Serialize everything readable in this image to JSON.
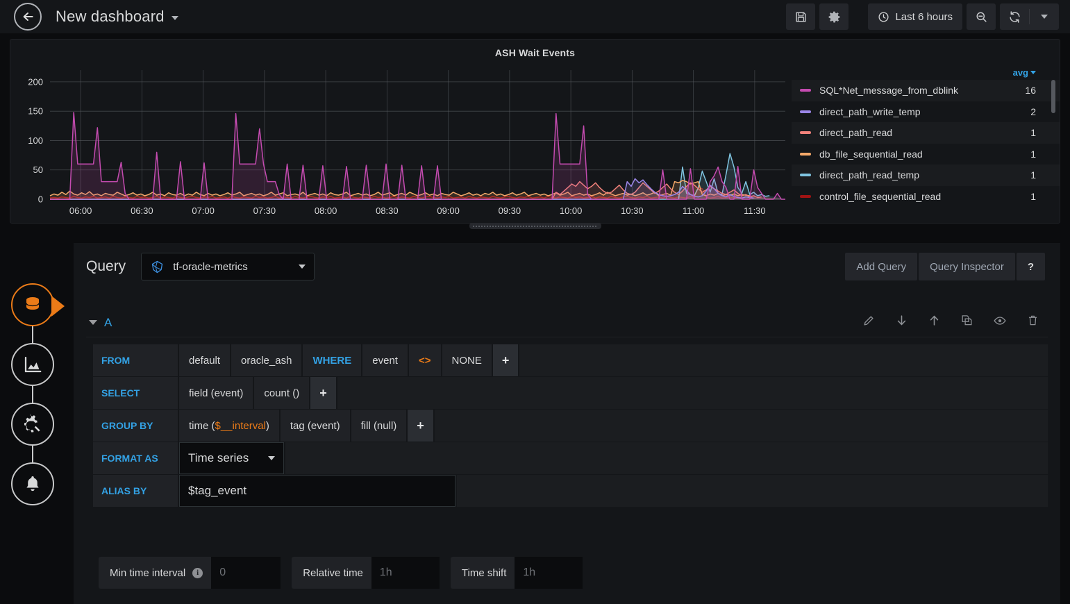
{
  "topnav": {
    "back_icon": "arrow-left-circle-icon",
    "title": "New dashboard",
    "save_icon": "save-disk-icon",
    "settings_icon": "gear-icon",
    "time_range": "Last 6 hours",
    "clock_icon": "clock-icon",
    "zoom_out_icon": "search-minus-icon",
    "refresh_icon": "refresh-icon",
    "refresh_caret_icon": "chevron-down-icon"
  },
  "panel": {
    "title": "ASH Wait Events",
    "legend_sort_label": "avg",
    "legend": [
      {
        "name": "SQL*Net_message_from_dblink",
        "value": "16",
        "color": "#c44bb0"
      },
      {
        "name": "direct_path_write_temp",
        "value": "2",
        "color": "#9b86e8"
      },
      {
        "name": "direct_path_read",
        "value": "1",
        "color": "#f2827b"
      },
      {
        "name": "db_file_sequential_read",
        "value": "1",
        "color": "#f5a96a"
      },
      {
        "name": "direct_path_read_temp",
        "value": "1",
        "color": "#7fc4e0"
      },
      {
        "name": "control_file_sequential_read",
        "value": "1",
        "color": "#a01313"
      }
    ]
  },
  "chart_data": {
    "type": "line",
    "title": "ASH Wait Events",
    "xlabel": "",
    "ylabel": "",
    "ylim": [
      0,
      220
    ],
    "yticks": [
      "0",
      "50",
      "100",
      "150",
      "200"
    ],
    "xticks": [
      "06:00",
      "06:30",
      "07:00",
      "07:30",
      "08:00",
      "08:30",
      "09:00",
      "09:30",
      "10:00",
      "10:30",
      "11:00",
      "11:30"
    ],
    "grid": true,
    "legend_position": "right",
    "legend_columns": [
      "avg"
    ],
    "series": [
      {
        "name": "SQL*Net_message_from_dblink",
        "color": "#c44bb0",
        "avg": 16,
        "values": [
          0,
          0,
          0,
          0,
          0,
          0,
          148,
          60,
          60,
          60,
          60,
          60,
          122,
          30,
          30,
          30,
          30,
          30,
          63,
          10,
          0,
          0,
          0,
          0,
          0,
          0,
          0,
          80,
          0,
          0,
          0,
          0,
          0,
          64,
          0,
          0,
          0,
          0,
          0,
          62,
          0,
          0,
          0,
          0,
          0,
          0,
          0,
          146,
          60,
          60,
          60,
          60,
          60,
          120,
          60,
          30,
          30,
          30,
          8,
          0,
          60,
          0,
          0,
          0,
          58,
          0,
          0,
          0,
          0,
          57,
          0,
          0,
          0,
          0,
          0,
          56,
          0,
          0,
          0,
          0,
          58,
          0,
          0,
          0,
          0,
          60,
          0,
          0,
          0,
          58,
          0,
          0,
          0,
          0,
          57,
          0,
          0,
          0,
          57,
          0,
          0,
          0,
          0,
          0,
          0,
          0,
          0,
          0,
          0,
          0,
          0,
          0,
          0,
          0,
          0,
          0,
          0,
          0,
          0,
          0,
          0,
          0,
          0,
          0,
          0,
          0,
          0,
          0,
          146,
          60,
          60,
          60,
          60,
          60,
          60,
          125,
          8,
          0,
          0,
          0,
          0,
          0,
          0,
          0,
          0,
          0,
          0,
          0,
          0,
          0,
          0,
          0,
          0,
          0,
          0,
          50,
          0,
          0,
          0,
          0,
          0,
          0,
          52,
          0,
          0,
          0,
          0,
          30,
          40,
          55,
          30,
          20,
          0,
          0,
          56,
          0,
          0,
          0,
          50,
          20,
          10,
          0,
          0,
          0,
          10,
          0,
          0
        ]
      },
      {
        "name": "direct_path_write_temp",
        "color": "#9b86e8",
        "avg": 2,
        "values": [
          0,
          0,
          0,
          0,
          0,
          0,
          0,
          0,
          0,
          0,
          0,
          0,
          0,
          0,
          0,
          0,
          0,
          0,
          0,
          0,
          0,
          0,
          0,
          0,
          0,
          0,
          0,
          0,
          0,
          0,
          0,
          0,
          0,
          0,
          0,
          0,
          0,
          0,
          0,
          0,
          0,
          0,
          0,
          0,
          0,
          0,
          0,
          0,
          0,
          0,
          0,
          0,
          0,
          0,
          0,
          0,
          0,
          0,
          0,
          0,
          0,
          0,
          0,
          0,
          0,
          0,
          0,
          0,
          0,
          0,
          0,
          0,
          0,
          0,
          0,
          0,
          0,
          0,
          0,
          0,
          0,
          0,
          0,
          0,
          0,
          0,
          0,
          0,
          0,
          0,
          0,
          0,
          0,
          0,
          0,
          0,
          0,
          0,
          0,
          0,
          0,
          0,
          0,
          0,
          0,
          0,
          0,
          0,
          0,
          0,
          0,
          0,
          0,
          0,
          0,
          0,
          0,
          0,
          0,
          0,
          0,
          0,
          0,
          0,
          0,
          0,
          0,
          0,
          0,
          0,
          0,
          0,
          0,
          0,
          0,
          0,
          0,
          0,
          0,
          0,
          0,
          0,
          0,
          0,
          0,
          0,
          30,
          22,
          35,
          28,
          33,
          25,
          18,
          12,
          8,
          6,
          5,
          6,
          8,
          12,
          22,
          15,
          8,
          5,
          4,
          6,
          14,
          24,
          18,
          10,
          6,
          4,
          8,
          5,
          3,
          2,
          4,
          3,
          2
        ]
      },
      {
        "name": "direct_path_read",
        "color": "#f2827b",
        "avg": 1,
        "values": [
          0,
          0,
          0,
          0,
          0,
          0,
          0,
          0,
          0,
          0,
          0,
          0,
          0,
          0,
          0,
          0,
          0,
          0,
          0,
          0,
          0,
          0,
          0,
          0,
          0,
          0,
          0,
          0,
          0,
          0,
          0,
          0,
          0,
          0,
          0,
          0,
          0,
          0,
          0,
          0,
          0,
          0,
          0,
          0,
          0,
          0,
          0,
          0,
          0,
          0,
          0,
          0,
          0,
          0,
          0,
          0,
          0,
          0,
          0,
          0,
          0,
          0,
          0,
          0,
          0,
          0,
          0,
          0,
          0,
          0,
          0,
          0,
          0,
          0,
          0,
          0,
          0,
          0,
          0,
          0,
          0,
          0,
          0,
          0,
          0,
          0,
          0,
          0,
          0,
          0,
          0,
          0,
          0,
          0,
          0,
          0,
          0,
          0,
          0,
          0,
          0,
          0,
          0,
          0,
          0,
          0,
          0,
          0,
          0,
          0,
          0,
          0,
          0,
          0,
          0,
          0,
          0,
          0,
          0,
          0,
          0,
          0,
          0,
          0,
          0,
          0,
          0,
          0,
          12,
          8,
          14,
          20,
          26,
          22,
          30,
          24,
          18,
          22,
          28,
          20,
          14,
          10,
          12,
          18,
          24,
          16,
          10,
          8,
          12,
          20,
          28,
          22,
          16,
          10,
          14,
          20,
          26,
          18,
          12,
          8,
          14,
          22,
          28,
          24,
          18,
          12,
          16,
          22,
          18,
          14,
          10,
          8,
          12,
          16,
          10,
          6,
          8,
          4,
          6,
          3,
          4
        ]
      },
      {
        "name": "db_file_sequential_read",
        "color": "#f5a96a",
        "avg": 1,
        "values": [
          6,
          9,
          7,
          12,
          8,
          14,
          9,
          7,
          11,
          8,
          13,
          7,
          9,
          6,
          10,
          8,
          7,
          12,
          9,
          6,
          8,
          11,
          7,
          9,
          6,
          8,
          12,
          7,
          9,
          6,
          11,
          8,
          7,
          10,
          6,
          9,
          7,
          12,
          8,
          6,
          10,
          7,
          9,
          6,
          8,
          11,
          7,
          9,
          12,
          6,
          8,
          10,
          7,
          9,
          6,
          8,
          12,
          7,
          9,
          11,
          6,
          8,
          9,
          7,
          12,
          6,
          8,
          10,
          7,
          9,
          6,
          11,
          8,
          7,
          9,
          12,
          6,
          8,
          10,
          7,
          9,
          6,
          8,
          12,
          7,
          9,
          11,
          6,
          8,
          10,
          7,
          12,
          9,
          6,
          8,
          11,
          7,
          9,
          6,
          10,
          8,
          7,
          12,
          9,
          6,
          8,
          11,
          7,
          9,
          6,
          10,
          8,
          12,
          7,
          9,
          6,
          8,
          11,
          7,
          9,
          12,
          6,
          8,
          10,
          7,
          9,
          6,
          8,
          11,
          7,
          9,
          12,
          6,
          8,
          10,
          7,
          9,
          6,
          8,
          11,
          7,
          12,
          9,
          6,
          8,
          10,
          7,
          9,
          6,
          8,
          11,
          7,
          9,
          12,
          6,
          8,
          10,
          7,
          30,
          28,
          32,
          30,
          26,
          28,
          30,
          8,
          6,
          9,
          7,
          10,
          6,
          8,
          7,
          9,
          6,
          8,
          7,
          6
        ]
      },
      {
        "name": "direct_path_read_temp",
        "color": "#7fc4e0",
        "avg": 1,
        "values": [
          0,
          0,
          0,
          0,
          0,
          0,
          0,
          0,
          0,
          0,
          0,
          0,
          0,
          0,
          0,
          0,
          0,
          0,
          0,
          0,
          0,
          0,
          0,
          0,
          0,
          0,
          0,
          0,
          0,
          0,
          0,
          0,
          0,
          0,
          0,
          0,
          0,
          0,
          0,
          0,
          0,
          0,
          0,
          0,
          0,
          0,
          0,
          0,
          0,
          0,
          0,
          0,
          0,
          0,
          0,
          0,
          0,
          0,
          0,
          0,
          0,
          0,
          0,
          0,
          0,
          0,
          0,
          0,
          0,
          0,
          0,
          0,
          0,
          0,
          0,
          0,
          0,
          0,
          0,
          0,
          0,
          0,
          0,
          0,
          0,
          0,
          0,
          0,
          0,
          0,
          0,
          0,
          0,
          0,
          0,
          0,
          0,
          0,
          0,
          0,
          0,
          0,
          0,
          0,
          0,
          0,
          0,
          0,
          0,
          0,
          0,
          0,
          0,
          0,
          0,
          0,
          0,
          0,
          0,
          0,
          0,
          0,
          0,
          0,
          0,
          0,
          0,
          0,
          0,
          0,
          0,
          0,
          0,
          0,
          0,
          0,
          0,
          0,
          0,
          0,
          0,
          0,
          0,
          0,
          0,
          0,
          0,
          0,
          0,
          0,
          0,
          0,
          0,
          0,
          0,
          0,
          0,
          0,
          0,
          0,
          55,
          10,
          8,
          6,
          20,
          48,
          30,
          12,
          35,
          10,
          8,
          42,
          78,
          55,
          20,
          10,
          30,
          8,
          12,
          6,
          8,
          5,
          6
        ]
      },
      {
        "name": "control_file_sequential_read",
        "color": "#a01313",
        "avg": 1,
        "values": [
          2,
          3,
          2,
          4,
          3,
          2,
          5,
          3,
          2,
          4,
          3,
          5,
          2,
          3,
          4,
          2,
          5,
          3,
          2,
          4,
          3,
          2,
          5,
          3,
          4,
          2,
          3,
          5,
          2,
          4,
          3,
          2,
          5,
          3,
          2,
          4,
          5,
          3,
          2,
          4,
          3,
          5,
          2,
          3,
          4,
          2,
          5,
          3,
          2,
          4,
          3,
          2,
          5,
          3,
          4,
          2,
          3,
          5,
          2,
          4,
          3,
          2,
          5,
          3,
          2,
          4,
          5,
          3,
          2,
          4,
          3,
          5,
          2,
          3,
          4,
          2,
          5,
          3,
          2,
          4,
          3,
          2,
          5,
          3,
          4,
          2,
          3,
          5,
          2,
          4,
          3,
          2,
          5,
          3,
          2,
          4,
          5,
          3,
          2,
          4,
          3,
          5,
          2,
          3,
          4,
          2,
          5,
          3,
          2,
          4,
          3,
          2,
          5,
          3,
          2,
          4,
          5,
          3,
          2,
          4,
          3,
          5,
          2,
          3,
          4,
          2,
          5,
          3,
          2,
          4,
          3,
          2,
          5,
          3,
          4,
          2,
          3,
          5,
          2,
          4,
          3,
          2,
          5,
          3,
          2,
          4,
          5,
          3,
          2,
          4,
          3,
          5,
          2,
          3,
          4,
          2,
          5,
          3,
          2,
          4,
          3,
          2,
          5,
          3,
          20,
          18,
          4,
          2,
          3,
          5,
          2,
          3,
          4,
          2,
          3,
          2
        ]
      }
    ]
  },
  "rail": {
    "items": [
      {
        "name": "queries-tab",
        "icon": "database-icon",
        "active": true
      },
      {
        "name": "visualization-tab",
        "icon": "chart-area-icon",
        "active": false
      },
      {
        "name": "general-settings-tab",
        "icon": "gear-wrench-icon",
        "active": false
      },
      {
        "name": "alert-tab",
        "icon": "bell-icon",
        "active": false
      }
    ]
  },
  "editor": {
    "query_label": "Query",
    "datasource": "tf-oracle-metrics",
    "datasource_icon": "influxdb-icon",
    "add_query_label": "Add Query",
    "query_inspector_label": "Query Inspector",
    "help_label": "?",
    "query_row": {
      "ref_id": "A",
      "icons": [
        "pencil-icon",
        "arrow-down-icon",
        "arrow-up-icon",
        "duplicate-icon",
        "eye-icon",
        "trash-icon"
      ]
    },
    "rows": {
      "from_label": "FROM",
      "from_policy": "default",
      "from_measurement": "oracle_ash",
      "where_label": "WHERE",
      "where_key": "event",
      "where_op": "<>",
      "where_value": "NONE",
      "plus": "+",
      "select_label": "SELECT",
      "select_field": "field (event)",
      "select_agg": "count ()",
      "groupby_label": "GROUP BY",
      "groupby_time_prefix": "time (",
      "groupby_time_var": "$__interval",
      "groupby_time_suffix": ")",
      "groupby_tag": "tag (event)",
      "groupby_fill": "fill (null)",
      "format_label": "FORMAT AS",
      "format_value": "Time series",
      "alias_label": "ALIAS BY",
      "alias_value": "$tag_event"
    },
    "options": {
      "min_time_interval_label": "Min time interval",
      "min_time_interval_placeholder": "0",
      "min_time_interval_value": "",
      "relative_time_label": "Relative time",
      "relative_time_placeholder": "1h",
      "relative_time_value": "",
      "time_shift_label": "Time shift",
      "time_shift_placeholder": "1h",
      "time_shift_value": ""
    }
  }
}
